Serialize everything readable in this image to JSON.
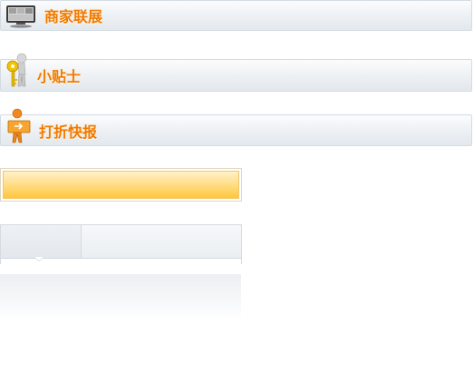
{
  "sections": {
    "merchant": {
      "title": "商家联展",
      "icon": "monitor-icon"
    },
    "tips": {
      "title": "小贴士",
      "icon": "key-figure-icon"
    },
    "news": {
      "title": "打折快报",
      "icon": "sign-figure-icon"
    }
  },
  "colors": {
    "title_text": "#f07a00",
    "bar_border": "#d4dbe3",
    "highlight": "#ffc63e"
  }
}
